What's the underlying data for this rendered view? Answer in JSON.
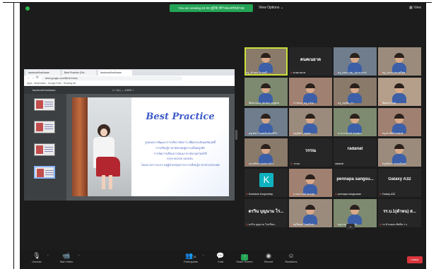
{
  "banner": {
    "sharing_text": "You are viewing 63-09 (ผู้ใช้) ที่กำลังแชร์หน้าจอ",
    "view_options": "View Options ⌄",
    "view_label": "View"
  },
  "browser": {
    "tabs": [
      "facebook/hariharan",
      "Best Practice (Onl...",
      "facebook/hariharan"
    ],
    "url": "drive.google.com/file/d/1/view",
    "bookmarks": "Apps  ·  Bookmarks  ·  Google Drive  ·  Reading list",
    "pdf_name": "facebook/hariharan",
    "page_indicator": "1 / 13   |   — 100% +"
  },
  "slide": {
    "title": "Best Practice",
    "lines": [
      "รูปแบบการพัฒนาการบริหารจัดการ เพื่อยกระดับผลสัมฤทธิ์",
      "การเรียนรู้ภาษาอังกฤษสู่ความเป็นครูเลิศ",
      "การจัดการเรียนการสอนภาษาอังกฤษโดยใช้",
      "KOH MOOK MODEL",
      "โดยนางสาวXXXX ครูผู้ช่วยกลุ่มสาระการเรียนรู้ภาษาต่างประเทศ"
    ]
  },
  "participants": [
    {
      "name": "ครู_ชไอยอ กินอนดี",
      "big": "",
      "kind": "cam",
      "muted": false,
      "active": true
    },
    {
      "name": "ดนคเนยาต",
      "big": "ดนคเนยาต",
      "kind": "text",
      "muted": true,
      "active": false
    },
    {
      "name": "ครู_ธหนา สด_ (สาขาแรก)",
      "big": "",
      "kind": "cam",
      "muted": true,
      "active": false
    },
    {
      "name": "ครู_บรรณ ธนาศรีสุข",
      "big": "",
      "kind": "cam",
      "muted": true,
      "active": false
    },
    {
      "name": "พัฒนาแผน_สมปอง_ครูสุทน",
      "big": "",
      "kind": "cam",
      "muted": true,
      "active": false
    },
    {
      "name": "การสอน_ครู_เปรม",
      "big": "",
      "kind": "cam",
      "muted": true,
      "active": false
    },
    {
      "name": "ครู_บุญชัย_ภา",
      "big": "",
      "kind": "cam",
      "muted": true,
      "active": false
    },
    {
      "name": "ชัยเดช Chai",
      "big": "",
      "kind": "cam",
      "muted": true,
      "active": false
    },
    {
      "name": "ครูเพชร วิมลหลักเล็กศรีกำ",
      "big": "",
      "kind": "cam",
      "muted": true,
      "active": false
    },
    {
      "name": "ครูสุนิสา_ชุมพล",
      "big": "",
      "kind": "cam",
      "muted": true,
      "active": false
    },
    {
      "name": "นางวรรณ์ตน์ สกุลทอง",
      "big": "",
      "kind": "cam",
      "muted": true,
      "active": false
    },
    {
      "name": "ครูประสิทธิ์ สมพงษ์",
      "big": "",
      "kind": "cam",
      "muted": true,
      "active": false
    },
    {
      "name": "ครูวสุรัตน์ คนพยานจิรา",
      "big": "",
      "kind": "cam",
      "muted": true,
      "active": false
    },
    {
      "name": "วรรณ",
      "big": "วรรณ",
      "kind": "text",
      "muted": true,
      "active": false
    },
    {
      "name": "radanat",
      "big": "radanat",
      "kind": "text",
      "muted": false,
      "active": false
    },
    {
      "name": "ครูสุจินดา ธรรมจันทร์",
      "big": "",
      "kind": "cam",
      "muted": true,
      "active": false
    },
    {
      "name": "Konlalum Konjunetep",
      "big": "K",
      "kind": "avatar",
      "muted": true,
      "active": false
    },
    {
      "name": "นางเยาวชน์ ทรงสุข",
      "big": "",
      "kind": "cam",
      "muted": true,
      "active": false
    },
    {
      "name": "pennapa sangsuwan",
      "big": "pennapa sangsu...",
      "kind": "text",
      "muted": true,
      "active": false
    },
    {
      "name": "Galaxy A32",
      "big": "Galaxy A32",
      "kind": "text",
      "muted": true,
      "active": false
    },
    {
      "name": "ดรวิน บุญนาม โรงเรียน...",
      "big": "ดรวิน บุญนาม โร...",
      "kind": "text",
      "muted": true,
      "active": false
    },
    {
      "name": "ครูปิยนุช ไหลสักพร",
      "big": "",
      "kind": "cam",
      "muted": true,
      "active": false
    },
    {
      "name": "ครูอานนท์ ทองคำ",
      "big": "",
      "kind": "cam",
      "muted": true,
      "active": false
    },
    {
      "name": "รร.บ้านดอน ทับทิม ร.ร.",
      "big": "รร.บ.1(ตำหน) ส...",
      "kind": "text",
      "muted": true,
      "active": false
    }
  ],
  "toolbar": {
    "unmute": "Unmute",
    "start_video": "Start Video",
    "participants": "Participants",
    "participants_count": "31",
    "chat": "Chat",
    "share_screen": "Share Screen",
    "record": "Record",
    "reactions": "Reactions",
    "leave": "Leave"
  }
}
